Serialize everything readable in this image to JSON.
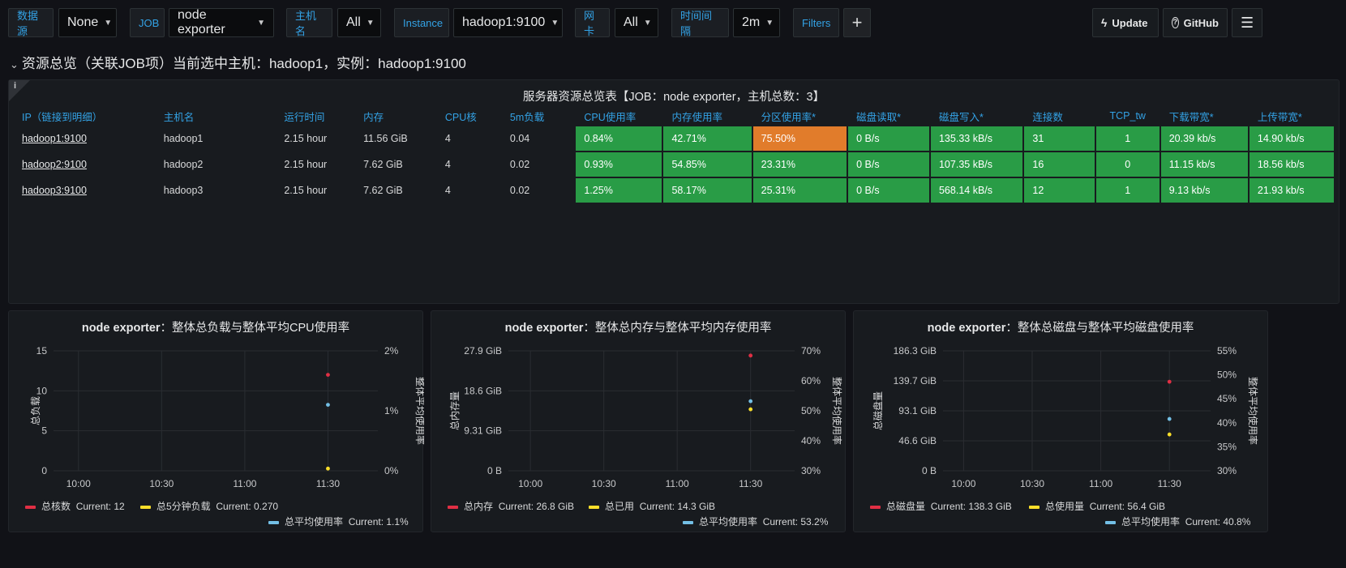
{
  "toolbar": {
    "datasource_label": "数据源",
    "datasource_value": "None",
    "job_label": "JOB",
    "job_value": "node exporter",
    "host_label": "主机名",
    "host_value": "All",
    "instance_label": "Instance",
    "instance_value": "hadoop1:9100",
    "nic_label": "网卡",
    "nic_value": "All",
    "interval_label": "时间间隔",
    "interval_value": "2m",
    "filters_label": "Filters",
    "add_label": "+",
    "update_label": "Update",
    "github_label": "GitHub"
  },
  "row": {
    "title": "资源总览（关联JOB项）当前选中主机：hadoop1，实例：hadoop1:9100"
  },
  "table_panel": {
    "info": "i",
    "title": "服务器资源总览表【JOB：node exporter，主机总数：3】",
    "columns": [
      "IP（链接到明细）",
      "主机名",
      "运行时间",
      "内存",
      "CPU核",
      "5m负载",
      "CPU使用率",
      "内存使用率",
      "分区使用率*",
      "磁盘读取*",
      "磁盘写入*",
      "连接数",
      "TCP_tw",
      "下载带宽*",
      "上传带宽*"
    ],
    "rows": [
      [
        "hadoop1:9100",
        "hadoop1",
        "2.15 hour",
        "11.56 GiB",
        "4",
        "0.04",
        "0.84%",
        "42.71%",
        "75.50%",
        "0 B/s",
        "135.33 kB/s",
        "31",
        "1",
        "20.39 kb/s",
        "14.90 kb/s"
      ],
      [
        "hadoop2:9100",
        "hadoop2",
        "2.15 hour",
        "7.62 GiB",
        "4",
        "0.02",
        "0.93%",
        "54.85%",
        "23.31%",
        "0 B/s",
        "107.35 kB/s",
        "16",
        "0",
        "11.15 kb/s",
        "18.56 kb/s"
      ],
      [
        "hadoop3:9100",
        "hadoop3",
        "2.15 hour",
        "7.62 GiB",
        "4",
        "0.02",
        "1.25%",
        "58.17%",
        "25.31%",
        "0 B/s",
        "568.14 kB/s",
        "12",
        "1",
        "9.13 kb/s",
        "21.93 kb/s"
      ]
    ]
  },
  "colors": {
    "red": "#e02f44",
    "yellow": "#fade2a",
    "cyan": "#73bfe5",
    "green": "#299c46",
    "orange": "#e17c2b",
    "link": "#33a2e5"
  },
  "chart_data": [
    {
      "type": "scatter",
      "title_en": "node exporter",
      "title_cn": "：整体总负载与整体平均CPU使用率",
      "ylabel": "总负载",
      "y2label": "整体平均使用率",
      "xticks": [
        "10:00",
        "10:30",
        "11:00",
        "11:30"
      ],
      "yticks": [
        "0",
        "5",
        "10",
        "15"
      ],
      "ylim": [
        0,
        15
      ],
      "y2ticks": [
        "0%",
        "1%",
        "2%"
      ],
      "y2lim": [
        0,
        2
      ],
      "series": [
        {
          "name": "总核数",
          "axis": "left",
          "color": "#e02f44",
          "x": "11:30",
          "y": 12,
          "legend": "Current: 12"
        },
        {
          "name": "总5分钟负载",
          "axis": "left",
          "color": "#fade2a",
          "x": "11:30",
          "y": 0.27,
          "legend": "Current: 0.270"
        },
        {
          "name": "总平均使用率",
          "axis": "right",
          "color": "#73bfe5",
          "x": "11:30",
          "y": 1.1,
          "legend": "Current: 1.1%"
        }
      ]
    },
    {
      "type": "scatter",
      "title_en": "node exporter",
      "title_cn": "：整体总内存与整体平均内存使用率",
      "ylabel": "总内存量",
      "y2label": "整体平均使用率",
      "xticks": [
        "10:00",
        "10:30",
        "11:00",
        "11:30"
      ],
      "yticks": [
        "0 B",
        "9.31 GiB",
        "18.6 GiB",
        "27.9 GiB"
      ],
      "ylim": [
        0,
        27.9
      ],
      "y2ticks": [
        "30%",
        "40%",
        "50%",
        "60%",
        "70%"
      ],
      "y2lim": [
        30,
        70
      ],
      "series": [
        {
          "name": "总内存",
          "axis": "left",
          "color": "#e02f44",
          "x": "11:30",
          "y": 26.8,
          "legend": "Current: 26.8 GiB"
        },
        {
          "name": "总已用",
          "axis": "left",
          "color": "#fade2a",
          "x": "11:30",
          "y": 14.3,
          "legend": "Current: 14.3 GiB"
        },
        {
          "name": "总平均使用率",
          "axis": "right",
          "color": "#73bfe5",
          "x": "11:30",
          "y": 53.2,
          "legend": "Current: 53.2%"
        }
      ]
    },
    {
      "type": "scatter",
      "title_en": "node exporter",
      "title_cn": "：整体总磁盘与整体平均磁盘使用率",
      "ylabel": "总磁盘量",
      "y2label": "整体平均使用率",
      "xticks": [
        "10:00",
        "10:30",
        "11:00",
        "11:30"
      ],
      "yticks": [
        "0 B",
        "46.6 GiB",
        "93.1 GiB",
        "139.7 GiB",
        "186.3 GiB"
      ],
      "ylim": [
        0,
        186.3
      ],
      "y2ticks": [
        "30%",
        "35%",
        "40%",
        "45%",
        "50%",
        "55%"
      ],
      "y2lim": [
        30,
        55
      ],
      "series": [
        {
          "name": "总磁盘量",
          "axis": "left",
          "color": "#e02f44",
          "x": "11:30",
          "y": 138.3,
          "legend": "Current: 138.3 GiB"
        },
        {
          "name": "总使用量",
          "axis": "left",
          "color": "#fade2a",
          "x": "11:30",
          "y": 56.4,
          "legend": "Current: 56.4 GiB"
        },
        {
          "name": "总平均使用率",
          "axis": "right",
          "color": "#73bfe5",
          "x": "11:30",
          "y": 40.8,
          "legend": "Current: 40.8%"
        }
      ]
    }
  ]
}
